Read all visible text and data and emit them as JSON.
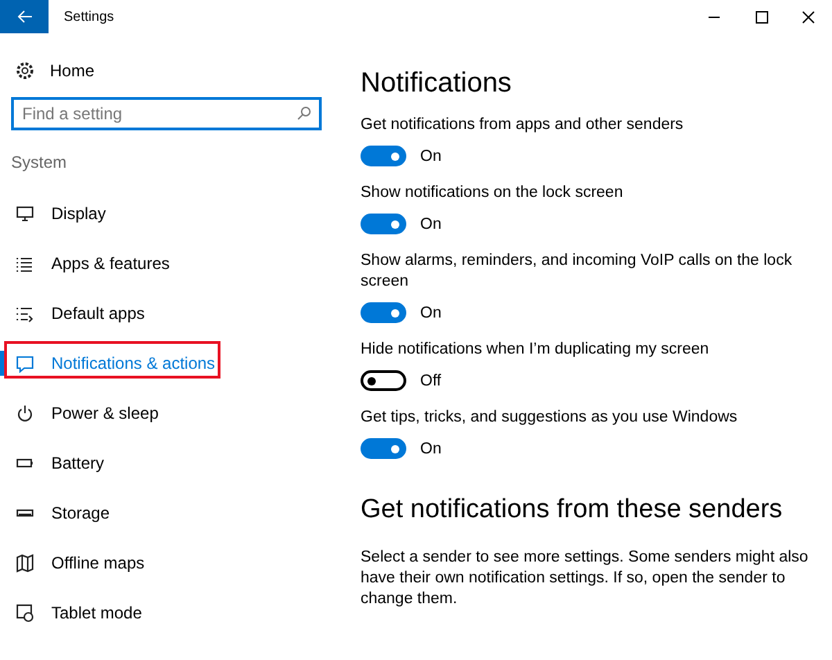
{
  "window": {
    "title": "Settings"
  },
  "sidebar": {
    "home": "Home",
    "search": {
      "placeholder": "Find a setting"
    },
    "section": "System",
    "items": [
      {
        "label": "Display",
        "selected": false,
        "highlighted": false
      },
      {
        "label": "Apps & features",
        "selected": false,
        "highlighted": false
      },
      {
        "label": "Default apps",
        "selected": false,
        "highlighted": false
      },
      {
        "label": "Notifications & actions",
        "selected": true,
        "highlighted": true
      },
      {
        "label": "Power & sleep",
        "selected": false,
        "highlighted": false
      },
      {
        "label": "Battery",
        "selected": false,
        "highlighted": false
      },
      {
        "label": "Storage",
        "selected": false,
        "highlighted": false
      },
      {
        "label": "Offline maps",
        "selected": false,
        "highlighted": false
      },
      {
        "label": "Tablet mode",
        "selected": false,
        "highlighted": false
      }
    ]
  },
  "main": {
    "heading": "Notifications",
    "settings": [
      {
        "label": "Get notifications from apps and other senders",
        "on": true,
        "state": "On"
      },
      {
        "label": "Show notifications on the lock screen",
        "on": true,
        "state": "On"
      },
      {
        "label": "Show alarms, reminders, and incoming VoIP calls on the lock screen",
        "on": true,
        "state": "On"
      },
      {
        "label": "Hide notifications when I’m duplicating my screen",
        "on": false,
        "state": "Off"
      },
      {
        "label": "Get tips, tricks, and suggestions as you use Windows",
        "on": true,
        "state": "On"
      }
    ],
    "senders_heading": "Get notifications from these senders",
    "senders_text": "Select a sender to see more settings. Some senders might also have their own notification settings. If so, open the sender to change them."
  }
}
